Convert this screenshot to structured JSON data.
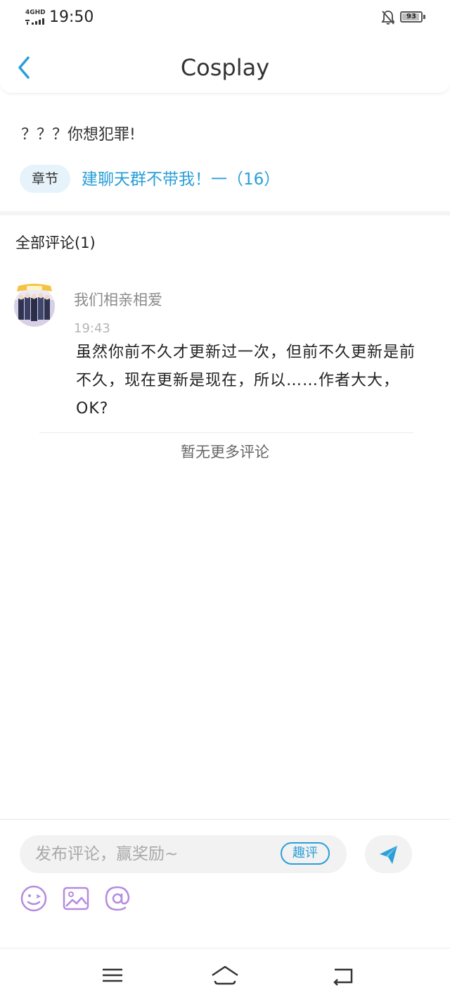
{
  "status_bar": {
    "network_label": "4GHD",
    "time": "19:50",
    "battery_level": "93",
    "icons": [
      "signal-icon",
      "bell-muted-icon",
      "battery-icon"
    ]
  },
  "header": {
    "back_icon": "chevron-left-icon",
    "title": "Cosplay"
  },
  "post": {
    "text": "？？？你想犯罪!",
    "chapter_tag": "章节",
    "chapter_title": "建聊天群不带我！一（16）"
  },
  "comments": {
    "header": "全部评论(1)",
    "items": [
      {
        "username": "我们相亲相爱",
        "time": "19:43",
        "text": "虽然你前不久才更新过一次，但前不久更新是前不久，现在更新是现在，所以……作者大大，OK?"
      }
    ],
    "end_label": "暂无更多评论"
  },
  "composer": {
    "placeholder": "发布评论，赢奖励~",
    "fun_button_label": "趣评",
    "send_icon": "send-icon",
    "tools": [
      "emoji-icon",
      "image-icon",
      "mention-icon"
    ]
  },
  "nav_bar": {
    "icons": [
      "menu-icon",
      "home-icon",
      "back-icon"
    ]
  },
  "colors": {
    "accent": "#2a9fd8",
    "tool_icon": "#b48be0",
    "tag_bg": "#e6f3fb"
  }
}
